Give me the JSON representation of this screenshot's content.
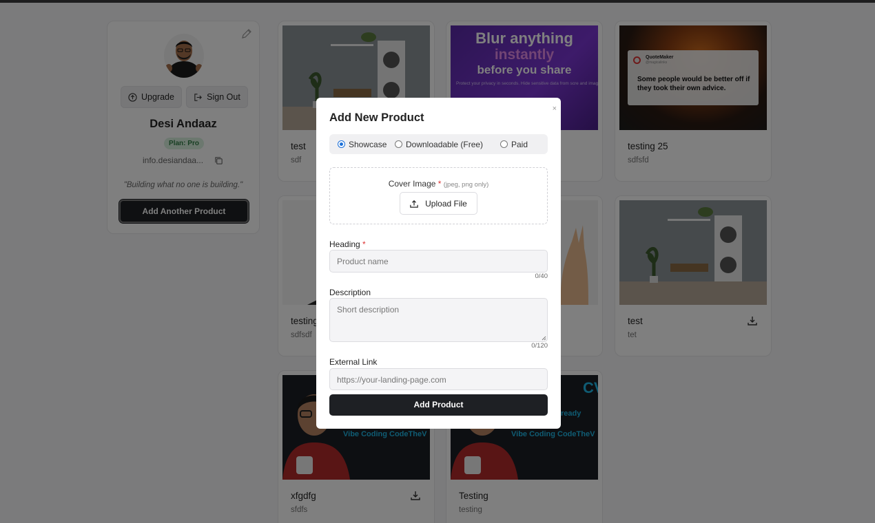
{
  "profile": {
    "name": "Desi Andaaz",
    "plan": "Plan: Pro",
    "email": "info.desiandaa...",
    "quote": "\"Building what no one is building.\"",
    "upgrade_label": "Upgrade",
    "signout_label": "Sign Out",
    "add_another_label": "Add Another Product"
  },
  "products": [
    {
      "title": "test",
      "desc": "sdf"
    },
    {
      "title": "",
      "desc": ""
    },
    {
      "title": "testing 25",
      "desc": "sdfsfd"
    },
    {
      "title": "testing",
      "desc": "sdfsdf"
    },
    {
      "title": "",
      "desc": ""
    },
    {
      "title": "test",
      "desc": "tet"
    },
    {
      "title": "xfgdfg",
      "desc": "sfdfs"
    },
    {
      "title": "Testing",
      "desc": "testing"
    }
  ],
  "thumbnails": {
    "blur": {
      "line1": "Blur anything",
      "line2": "instantly",
      "line3": "before you share",
      "sub": "Protect your privacy in seconds. Hide sensitive data from scre and images with professional-grade blurring tools."
    },
    "quote": {
      "brand": "QuoteMaker",
      "handle": "@magicalinks",
      "text": "Some people would be better off if they took their own advice."
    },
    "vibe": {
      "ready": "ready",
      "tagline": "Vibe Coding CodeTheV",
      "logo": "CV"
    }
  },
  "modal": {
    "title": "Add New Product",
    "close": "×",
    "types": [
      "Showcase",
      "Downloadable (Free)",
      "Paid"
    ],
    "selected_type": "Showcase",
    "cover_label": "Cover Image",
    "required_mark": "*",
    "cover_hint": "(jpeg, png only)",
    "upload_label": "Upload File",
    "heading_label": "Heading",
    "heading_placeholder": "Product name",
    "heading_count": "0/40",
    "description_label": "Description",
    "description_placeholder": "Short description",
    "description_count": "0/120",
    "link_label": "External Link",
    "link_placeholder": "https://your-landing-page.com",
    "submit_label": "Add Product"
  }
}
